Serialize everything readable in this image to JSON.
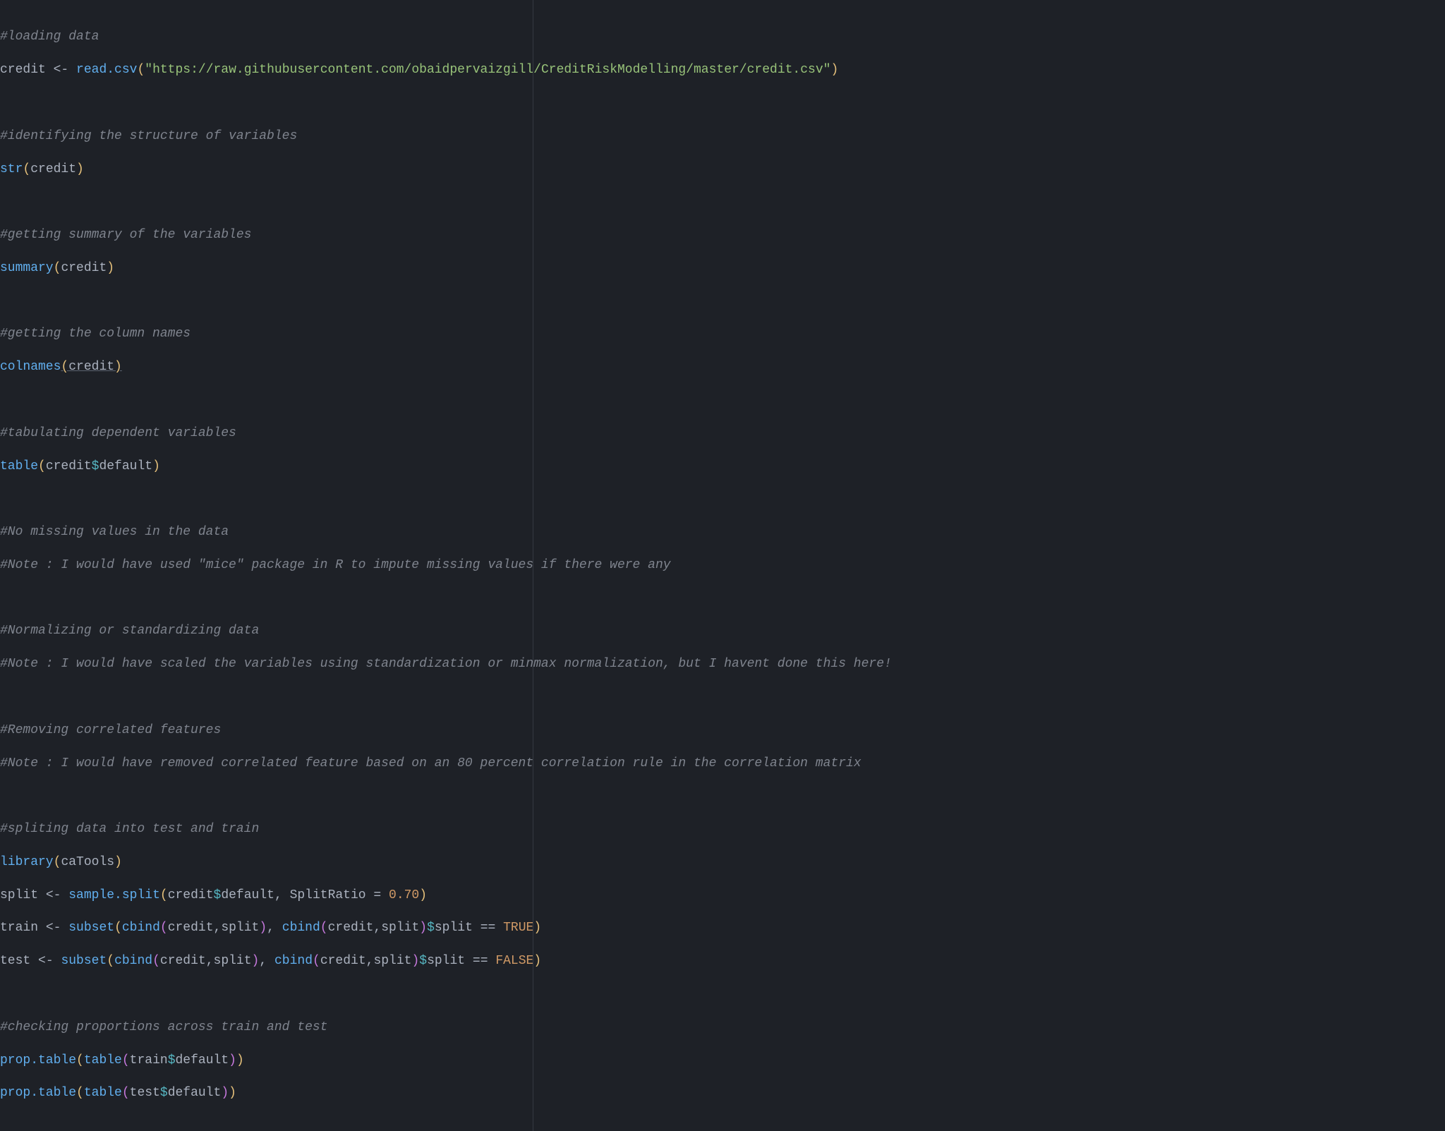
{
  "code": {
    "c1": "#loading data",
    "id_credit": "credit",
    "assign": "<-",
    "fn_readcsv": "read.csv",
    "str_url": "\"https://raw.githubusercontent.com/obaidpervaizgill/CreditRiskModelling/master/credit.csv\"",
    "c2": "#identifying the structure of variables",
    "fn_str": "str",
    "c3": "#getting summary of the variables",
    "fn_summary": "summary",
    "c4": "#getting the column names",
    "fn_colnames": "colnames",
    "c5": "#tabulating dependent variables",
    "fn_table": "table",
    "id_default": "default",
    "c6": "#No missing values in the data",
    "c7": "#Note : I would have used \"mice\" package in R to impute missing values if there were any",
    "c8": "#Normalizing or standardizing data",
    "c9": "#Note : I would have scaled the variables using standardization or minmax normalization, but I havent done this here!",
    "c10": "#Removing correlated features",
    "c11": "#Note : I would have removed correlated feature based on an 80 percent correlation rule in the correlation matrix",
    "c12": "#spliting data into test and train",
    "fn_library": "library",
    "id_catools": "caTools",
    "id_split": "split",
    "fn_samplesplit": "sample.split",
    "id_splitratio": "SplitRatio",
    "eq": "=",
    "num_070": "0.70",
    "id_train": "train",
    "fn_subset": "subset",
    "fn_cbind": "cbind",
    "eqeq": "==",
    "bool_true": "TRUE",
    "id_test": "test",
    "bool_false": "FALSE",
    "c13": "#checking proportions across train and test",
    "fn_proptable": "prop.table",
    "comma": ",",
    "lparen": "(",
    "rparen": ")",
    "dollar": "$",
    "space": " "
  }
}
